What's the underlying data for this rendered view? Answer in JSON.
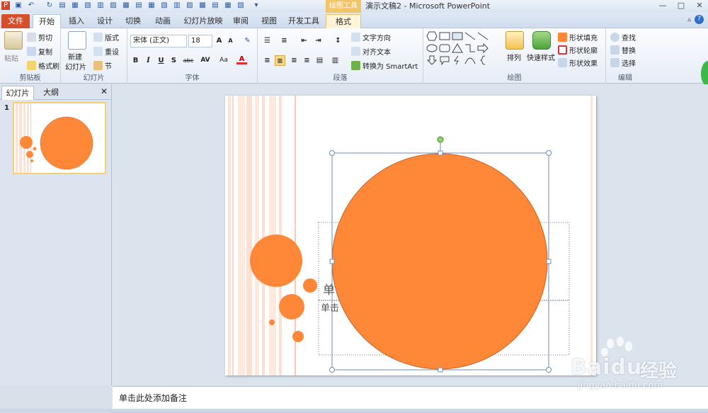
{
  "window": {
    "title": "演示文稿2 - Microsoft PowerPoint",
    "context_tab_group": "绘图工具",
    "controls": [
      "—",
      "□",
      "✕"
    ]
  },
  "tabs": [
    {
      "label": "文件",
      "kind": "file"
    },
    {
      "label": "开始",
      "kind": "active"
    },
    {
      "label": "插入"
    },
    {
      "label": "设计"
    },
    {
      "label": "切换"
    },
    {
      "label": "动画"
    },
    {
      "label": "幻灯片放映"
    },
    {
      "label": "审阅"
    },
    {
      "label": "视图"
    },
    {
      "label": "开发工具"
    },
    {
      "label": "格式",
      "kind": "format"
    }
  ],
  "ribbon": {
    "clipboard": {
      "paste": "粘贴",
      "cut": "剪切",
      "copy": "复制",
      "painter": "格式刷",
      "label": "剪贴板"
    },
    "slides": {
      "new_slide": "新建",
      "new_slide_2": "幻灯片",
      "layout": "版式",
      "reset": "重设",
      "section": "节",
      "label": "幻灯片"
    },
    "font": {
      "name": "宋体 (正文)",
      "size": "18",
      "label": "字体",
      "buttons": [
        "B",
        "I",
        "U",
        "S",
        "abc",
        "AV",
        "Aa",
        "A"
      ]
    },
    "paragraph": {
      "text_dir": "文字方向",
      "align_text": "对齐文本",
      "smartart": "转换为 SmartArt",
      "label": "段落"
    },
    "drawing": {
      "arrange": "排列",
      "quick_styles": "快速样式",
      "fill": "形状填充",
      "outline": "形状轮廓",
      "effects": "形状效果",
      "label": "绘图"
    },
    "editing": {
      "find": "查找",
      "replace": "替换",
      "select": "选择",
      "label": "编辑"
    }
  },
  "left_pane": {
    "tabs": [
      "幻灯片",
      "大纲"
    ],
    "close": "✕",
    "slide_number": "1"
  },
  "slide": {
    "title_placeholder_partial": "单",
    "subtitle_placeholder_partial": "单击"
  },
  "notes": {
    "placeholder": "单击此处添加备注"
  },
  "watermark": {
    "brand": "Bai",
    "brand2": "du",
    "word": "经验",
    "url": "jingyan.baidu.com"
  },
  "colors": {
    "accent_orange": "#fe8837",
    "file_tab": "#d64f2b",
    "context_tab": "#f3c566",
    "selection": "#6b8bb9"
  }
}
